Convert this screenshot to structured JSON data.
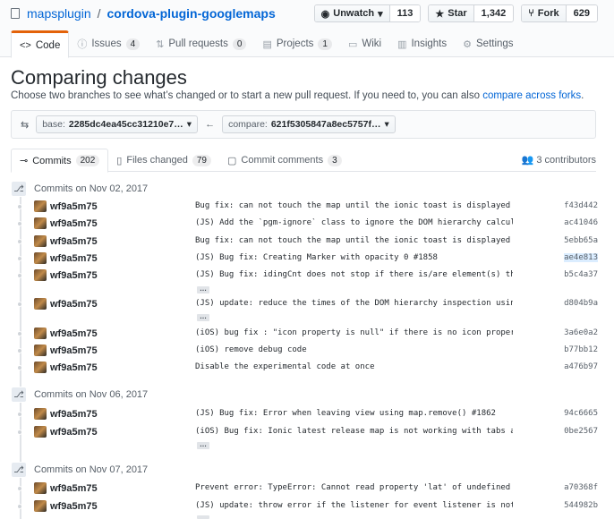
{
  "repo": {
    "owner": "mapsplugin",
    "name": "cordova-plugin-googlemaps"
  },
  "actions": {
    "watch_label": "Unwatch",
    "watch_count": "113",
    "star_label": "Star",
    "star_count": "1,342",
    "fork_label": "Fork",
    "fork_count": "629"
  },
  "tabs": [
    {
      "label": "Code"
    },
    {
      "label": "Issues",
      "count": "4"
    },
    {
      "label": "Pull requests",
      "count": "0"
    },
    {
      "label": "Projects",
      "count": "1"
    },
    {
      "label": "Wiki"
    },
    {
      "label": "Insights"
    },
    {
      "label": "Settings"
    }
  ],
  "page": {
    "title": "Comparing changes",
    "desc_pre": "Choose two branches to see what’s changed or to start a new pull request. If you need to, you can also ",
    "desc_link": "compare across forks",
    "desc_post": "."
  },
  "range": {
    "base_key": "base:",
    "base_value": "2285dc4ea45cc31210e7…",
    "compare_key": "compare:",
    "compare_value": "621f5305847a8ec5757f…"
  },
  "ctabs": [
    {
      "label": "Commits",
      "count": "202"
    },
    {
      "label": "Files changed",
      "count": "79"
    },
    {
      "label": "Commit comments",
      "count": "3"
    }
  ],
  "contributors": "3 contributors",
  "groups": [
    {
      "date": "Commits on Nov 02, 2017"
    },
    {
      "date": "Commits on Nov 06, 2017"
    },
    {
      "date": "Commits on Nov 07, 2017"
    }
  ],
  "commits": [
    {
      "author": "wf9a5m75",
      "msg": "Bug fix: can not touch the map until the ionic toast is displayed",
      "sha": "f43d442"
    },
    {
      "author": "wf9a5m75",
      "msg": "(JS) Add the `pgm-ignore` class to ignore the DOM hierarchy calculation",
      "sha": "ac41046"
    },
    {
      "author": "wf9a5m75",
      "msg": "Bug fix: can not touch the map until the ionic toast is displayed",
      "sha": "5ebb65a"
    },
    {
      "author": "wf9a5m75",
      "msg": "(JS) Bug fix: Creating Marker with opacity 0 #1858",
      "sha": "ae4e813"
    },
    {
      "author": "wf9a5m75",
      "msg": "(JS) Bug fix: idingCnt does not stop if there is/are element(s) that …",
      "sha": "b5c4a37"
    },
    {
      "author": "wf9a5m75",
      "msg": "(JS) update: reduce the times of the DOM hierarchy inspection using M…",
      "sha": "d804b9a"
    },
    {
      "author": "wf9a5m75",
      "msg": "(iOS) bug fix : \"icon property is null\" if there is no icon property",
      "sha": "3a6e0a2"
    },
    {
      "author": "wf9a5m75",
      "msg": "(iOS) remove debug code",
      "sha": "b77bb12"
    },
    {
      "author": "wf9a5m75",
      "msg": "Disable the experimental code at once",
      "sha": "a476b97"
    },
    {
      "author": "wf9a5m75",
      "msg": "(JS) Bug fix: Error when leaving view using map.remove() #1862",
      "sha": "94c6665"
    },
    {
      "author": "wf9a5m75",
      "msg": "(iOS) Bug fix: Ionic latest release map is not working with tabs and …",
      "sha": "0be2567"
    },
    {
      "author": "wf9a5m75",
      "msg": "Prevent error: TypeError: Cannot read property 'lat' of undefined",
      "sha": "a70368f"
    },
    {
      "author": "wf9a5m75",
      "msg": "(JS) update: throw error if the listener for event listener is not a …",
      "sha": "544982b"
    }
  ],
  "ellipsis": "…"
}
